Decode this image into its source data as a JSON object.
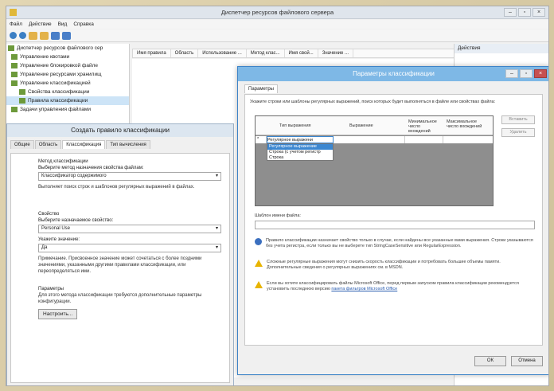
{
  "window": {
    "title": "Диспетчер ресурсов файлового сервера",
    "min": "–",
    "max": "▫",
    "close": "×"
  },
  "menu": [
    "Файл",
    "Действие",
    "Вид",
    "Справка"
  ],
  "tree": [
    "Диспетчер ресурсов файлового сер",
    "Управление квотами",
    "Управление блокировкой файле",
    "Управление ресурсами хранилищ",
    "Управление классификацией",
    "Свойства классификации",
    "Правила классификации",
    "Задачи управления файлами"
  ],
  "list": {
    "columns": [
      "Имя правила",
      "Область",
      "Использование ...",
      "Метод клас...",
      "Имя свой...",
      "Значение ..."
    ]
  },
  "actions": {
    "header": "Действия"
  },
  "rule_dialog": {
    "title": "Создать правило классификации",
    "tabs": [
      "Общие",
      "Область",
      "Классификация",
      "Тип вычисления"
    ],
    "method_label": "Метод классификации",
    "method_hint": "Выберите метод назначения свойства файлам:",
    "method_value": "Классификатор содержимого",
    "method_desc": "Выполняет поиск строк и шаблонов регулярных выражений в файлах.",
    "property_label": "Свойство",
    "property_hint": "Выберите назначаемое свойство:",
    "property_value": "Personal Use",
    "value_hint": "Укажите значение:",
    "value_value": "Да",
    "note": "Примечание. Присвоенное значение может сочетаться с более поздними значениями, указанными другими правилами классификации, или переопределяться ими.",
    "params_label": "Параметры",
    "params_desc": "Для этого метода классификации требуются дополнительные параметры конфигурации.",
    "configure_button": "Настроить..."
  },
  "params_dialog": {
    "title": "Параметры классификации",
    "tab": "Параметры",
    "instruction": "Укажите строки или шаблоны регулярных выражений, поиск которых будет выполняться в файле или свойствах файла:",
    "grid_columns": [
      "Тип выражения",
      "Выражение",
      "Минимальное число вхождений",
      "Максимальное число вхождений"
    ],
    "row_marker": "*",
    "row_value": "Регулярное выражени",
    "dropdown": [
      "Регулярное выражение",
      "Строка (с учетом регистр",
      "Строка"
    ],
    "side_buttons": [
      "Вставить",
      "Удалить"
    ],
    "template_label": "Шаблон имени файла:",
    "notes": [
      "Правило классификации назначает свойство только в случае, если найдены все указанные вами выражения. Строки указываются без учета регистра, если только вы не выберете тип StringCaseSensitive или RegularExpression.",
      "Сложные регулярные выражения могут снизить скорость классификации и потребовать большие объемы памяти. Дополнительные сведения о регулярных выражениях см. в MSDN.",
      "Если вы хотите классифицировать файлы Microsoft Office, перед первым запуском правила классификации рекомендуется установить последнюю версию "
    ],
    "note_link": "пакета фильтров Microsoft Office",
    "ok": "ОК",
    "cancel": "Отмена"
  }
}
